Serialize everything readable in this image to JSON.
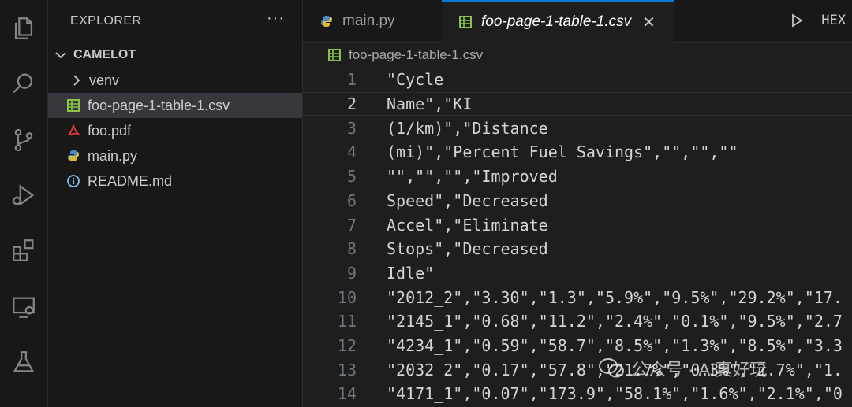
{
  "sidebar": {
    "header": "EXPLORER",
    "more": "···",
    "root": "CAMELOT",
    "items": [
      {
        "label": "venv",
        "type": "folder"
      },
      {
        "label": "foo-page-1-table-1.csv",
        "type": "csv",
        "selected": true
      },
      {
        "label": "foo.pdf",
        "type": "pdf"
      },
      {
        "label": "main.py",
        "type": "python"
      },
      {
        "label": "README.md",
        "type": "info"
      }
    ]
  },
  "tabs": [
    {
      "label": "main.py",
      "active": false
    },
    {
      "label": "foo-page-1-table-1.csv",
      "active": true,
      "close": "✕"
    }
  ],
  "toolbar": {
    "hex": "HEX"
  },
  "breadcrumb": {
    "file": "foo-page-1-table-1.csv"
  },
  "editor": {
    "current_line": 2,
    "lines": [
      {
        "n": "1",
        "text": "\"Cycle"
      },
      {
        "n": "2",
        "text": "Name\",\"KI"
      },
      {
        "n": "3",
        "text": "(1/km)\",\"Distance"
      },
      {
        "n": "4",
        "text": "(mi)\",\"Percent Fuel Savings\",\"\",\"\",\"\""
      },
      {
        "n": "5",
        "text": "\"\",\"\",\"\",\"Improved"
      },
      {
        "n": "6",
        "text": "Speed\",\"Decreased"
      },
      {
        "n": "7",
        "text": "Accel\",\"Eliminate"
      },
      {
        "n": "8",
        "text": "Stops\",\"Decreased"
      },
      {
        "n": "9",
        "text": "Idle\""
      },
      {
        "n": "10",
        "text": "\"2012_2\",\"3.30\",\"1.3\",\"5.9%\",\"9.5%\",\"29.2%\",\"17."
      },
      {
        "n": "11",
        "text": "\"2145_1\",\"0.68\",\"11.2\",\"2.4%\",\"0.1%\",\"9.5%\",\"2.7"
      },
      {
        "n": "12",
        "text": "\"4234_1\",\"0.59\",\"58.7\",\"8.5%\",\"1.3%\",\"8.5%\",\"3.3"
      },
      {
        "n": "13",
        "text": "\"2032_2\",\"0.17\",\"57.8\",\"21.7%\",\"0.3%\",\"2.7%\",\"1."
      },
      {
        "n": "14",
        "text": "\"4171_1\",\"0.07\",\"173.9\",\"58.1%\",\"1.6%\",\"2.1%\",\"0"
      }
    ]
  },
  "watermark": {
    "text": "公众号 · AI真好玩"
  }
}
